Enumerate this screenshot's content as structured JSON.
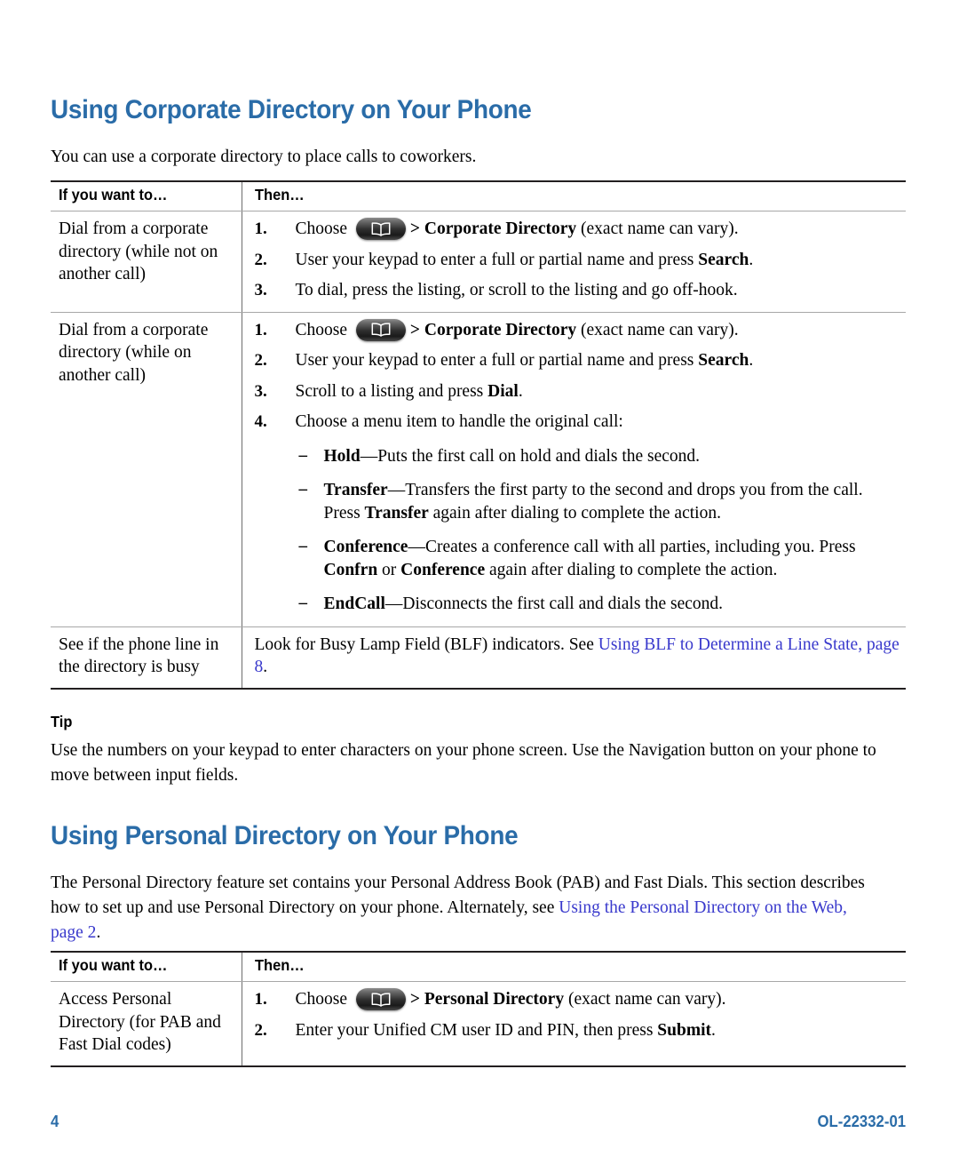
{
  "document": {
    "page_number": "4",
    "doc_id": "OL-22332-01",
    "heading_color": "#2a6ca8",
    "link_color": "#3939cc"
  },
  "section_corporate": {
    "heading": "Using Corporate Directory on Your Phone",
    "intro": "You can use a corporate directory to place calls to coworkers.",
    "table": {
      "headers": {
        "col_a": "If you want to…",
        "col_b": "Then…"
      },
      "rows": [
        {
          "condition": "Dial from a corporate directory (while not on another call)",
          "steps": [
            {
              "num": "1.",
              "pre": "Choose ",
              "icon": "directory-book-icon",
              "bold": "> Corporate Directory",
              "post": " (exact name can vary)."
            },
            {
              "num": "2.",
              "pre": "User your keypad to enter a full or partial name and press ",
              "bold": "Search",
              "post": "."
            },
            {
              "num": "3.",
              "pre": "To dial, press the listing, or scroll to the listing and go off-hook.",
              "bold": "",
              "post": ""
            }
          ]
        },
        {
          "condition": "Dial from a corporate directory (while on another call)",
          "steps": [
            {
              "num": "1.",
              "pre": "Choose ",
              "icon": "directory-book-icon",
              "bold": "> Corporate Directory",
              "post": " (exact name can vary)."
            },
            {
              "num": "2.",
              "pre": "User your keypad to enter a full or partial name and press ",
              "bold": "Search",
              "post": "."
            },
            {
              "num": "3.",
              "pre": "Scroll to a listing and press ",
              "bold": "Dial",
              "post": "."
            },
            {
              "num": "4.",
              "pre": "Choose a menu item to handle the original call:",
              "bold": "",
              "post": ""
            }
          ],
          "sublist": [
            {
              "term": "Hold",
              "text": "—Puts the first call on hold and dials the second."
            },
            {
              "term": "Transfer",
              "text": "—Transfers the first party to the second and drops you from the call. Press ",
              "bold_mid": "Transfer",
              "text2": " again after dialing to complete the action."
            },
            {
              "term": "Conference",
              "text": "—Creates a conference call with all parties, including you. Press ",
              "bold_mid": "Confrn",
              "text_mid2": " or ",
              "bold_mid2": "Conference",
              "text2": " again after dialing to complete the action."
            },
            {
              "term": "EndCall",
              "text": "—Disconnects the first call and dials the second."
            }
          ]
        },
        {
          "condition": "See if the phone line in the directory is busy",
          "plain_pre": "Look for Busy Lamp Field (BLF) indicators. See ",
          "link": "Using BLF to Determine a Line State, page 8",
          "plain_post": "."
        }
      ]
    },
    "tip": {
      "label": "Tip",
      "text": "Use the numbers on your keypad to enter characters on your phone screen. Use the Navigation button on your phone to move between input fields."
    }
  },
  "section_personal": {
    "heading": "Using Personal Directory on Your Phone",
    "paragraph_pre": "The Personal Directory feature set contains your Personal Address Book (PAB) and Fast Dials. This section describes how to set up and use Personal Directory on your phone. Alternately, see ",
    "paragraph_link": "Using the Personal Directory on the Web, page 2",
    "paragraph_post": ".",
    "table": {
      "headers": {
        "col_a": "If you want to…",
        "col_b": "Then…"
      },
      "rows": [
        {
          "condition": "Access Personal Directory (for PAB and Fast Dial codes)",
          "steps": [
            {
              "num": "1.",
              "pre": "Choose ",
              "icon": "directory-book-icon",
              "bold": "> Personal Directory",
              "post": " (exact name can vary)."
            },
            {
              "num": "2.",
              "pre": "Enter your Unified CM user ID and PIN, then press ",
              "bold": "Submit",
              "post": "."
            }
          ]
        }
      ]
    }
  }
}
